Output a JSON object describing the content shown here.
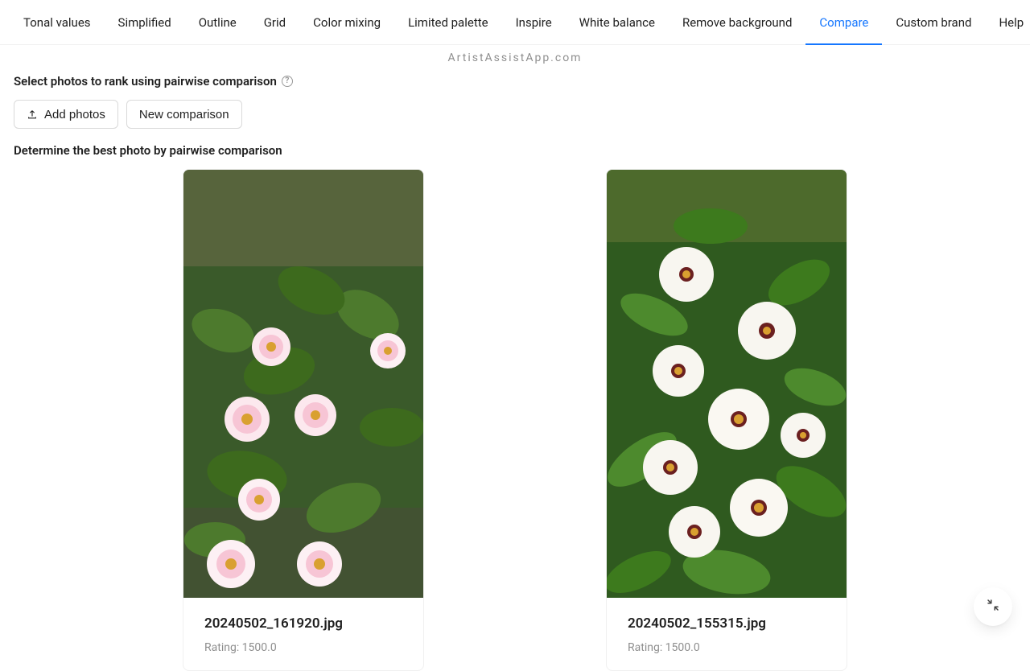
{
  "tabs": [
    {
      "label": "Tonal values"
    },
    {
      "label": "Simplified"
    },
    {
      "label": "Outline"
    },
    {
      "label": "Grid"
    },
    {
      "label": "Color mixing"
    },
    {
      "label": "Limited palette"
    },
    {
      "label": "Inspire"
    },
    {
      "label": "White balance"
    },
    {
      "label": "Remove background"
    },
    {
      "label": "Compare",
      "active": true
    },
    {
      "label": "Custom brand"
    },
    {
      "label": "Help"
    }
  ],
  "brand": "ArtistAssistApp.com",
  "section_title": "Select photos to rank using pairwise comparison",
  "buttons": {
    "add_photos": "Add photos",
    "new_comparison": "New comparison"
  },
  "section_title2": "Determine the best photo by pairwise comparison",
  "cards": [
    {
      "filename": "20240502_161920.jpg",
      "rating": "Rating: 1500.0"
    },
    {
      "filename": "20240502_155315.jpg",
      "rating": "Rating: 1500.0"
    }
  ],
  "icons": {
    "help": "help-circle-icon",
    "upload": "upload-icon",
    "minimize": "minimize-icon"
  }
}
